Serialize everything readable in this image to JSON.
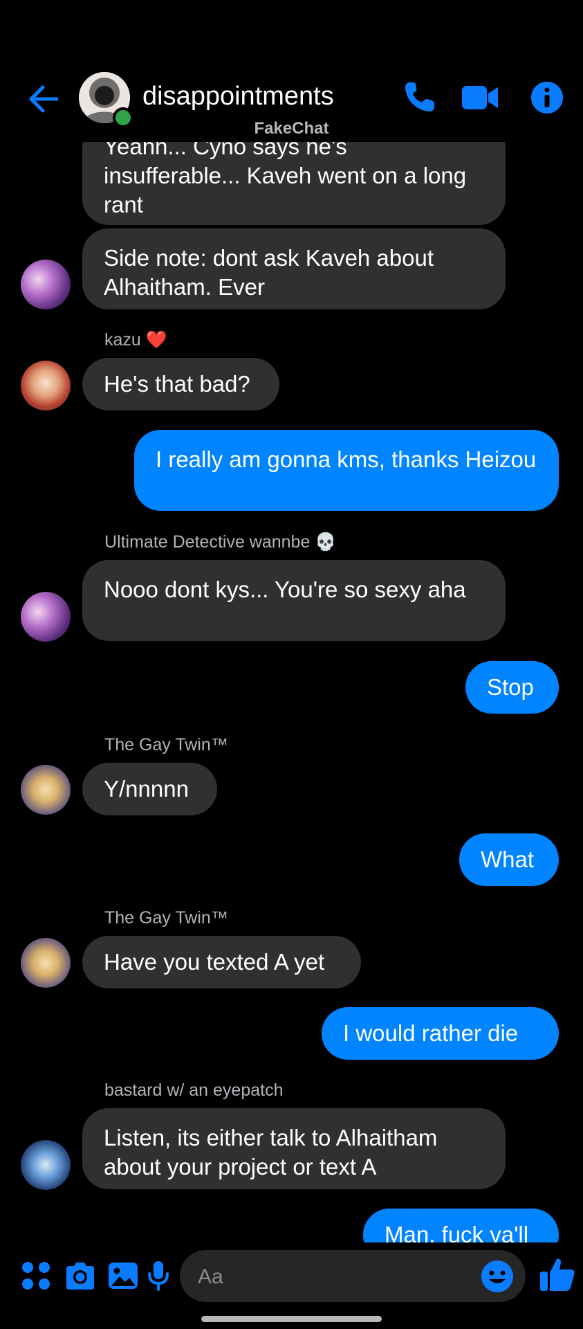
{
  "colors": {
    "accent": "#0084ff",
    "incoming_bubble": "#303030",
    "background": "#000000",
    "online": "#31a24c"
  },
  "header": {
    "title": "disappointments",
    "watermark": "FakeChat",
    "icons": [
      "back-arrow-icon",
      "phone-icon",
      "video-camera-icon",
      "info-icon"
    ]
  },
  "messages": [
    {
      "direction": "in",
      "text": "Yeahh... Cyno says he's insufferable... Kaveh went on a long rant"
    },
    {
      "direction": "in",
      "text": "Side note: dont ask Kaveh about Alhaitham. Ever"
    },
    {
      "direction": "in",
      "sender": "kazu",
      "sender_emoji": "❤️",
      "text": "He's that bad?"
    },
    {
      "direction": "out",
      "text": "I really am gonna kms, thanks Heizou"
    },
    {
      "direction": "in",
      "sender": "Ultimate Detective wannbe",
      "sender_emoji": "💀",
      "text": "Nooo dont kys... You're so sexy aha"
    },
    {
      "direction": "out",
      "text": "Stop"
    },
    {
      "direction": "in",
      "sender": "The Gay Twin™",
      "text": "Y/nnnnn"
    },
    {
      "direction": "out",
      "text": "What"
    },
    {
      "direction": "in",
      "sender": "The Gay Twin™",
      "text": "Have you texted A yet"
    },
    {
      "direction": "out",
      "text": "I would rather die"
    },
    {
      "direction": "in",
      "sender": "bastard w/ an eyepatch",
      "text": "Listen, its either talk to Alhaitham about your project or text A"
    },
    {
      "direction": "out",
      "text": "Man, fuck ya'll"
    }
  ],
  "composer": {
    "placeholder": "Aa",
    "icons": [
      "apps-grid-icon",
      "camera-icon",
      "gallery-icon",
      "microphone-icon",
      "emoji-icon",
      "thumbs-up-icon"
    ]
  }
}
